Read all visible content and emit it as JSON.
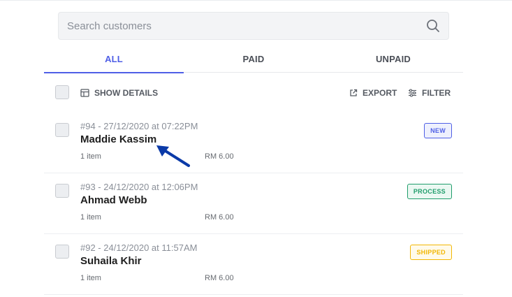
{
  "search": {
    "placeholder": "Search customers",
    "icon": "search-icon"
  },
  "tabs": [
    {
      "label": "ALL",
      "active": true
    },
    {
      "label": "PAID",
      "active": false
    },
    {
      "label": "UNPAID",
      "active": false
    }
  ],
  "toolbar": {
    "show_details_label": "SHOW DETAILS",
    "export_label": "EXPORT",
    "filter_label": "FILTER"
  },
  "orders": [
    {
      "meta": "#94 - 27/12/2020 at 07:22PM",
      "name": "Maddie Kassim",
      "items": "1 item",
      "price": "RM 6.00",
      "status": "NEW",
      "status_color": "#4f5fe6",
      "status_bg": "#eef0fd"
    },
    {
      "meta": "#93 - 24/12/2020 at 12:06PM",
      "name": "Ahmad Webb",
      "items": "1 item",
      "price": "RM 6.00",
      "status": "PROCESS",
      "status_color": "#1f9d6b",
      "status_bg": "#ebf8f2"
    },
    {
      "meta": "#92 - 24/12/2020 at 11:57AM",
      "name": "Suhaila Khir",
      "items": "1 item",
      "price": "RM 6.00",
      "status": "SHIPPED",
      "status_color": "#f2b705",
      "status_bg": "#fffaea"
    }
  ],
  "annotation": {
    "arrow_color": "#0b3aa8"
  }
}
